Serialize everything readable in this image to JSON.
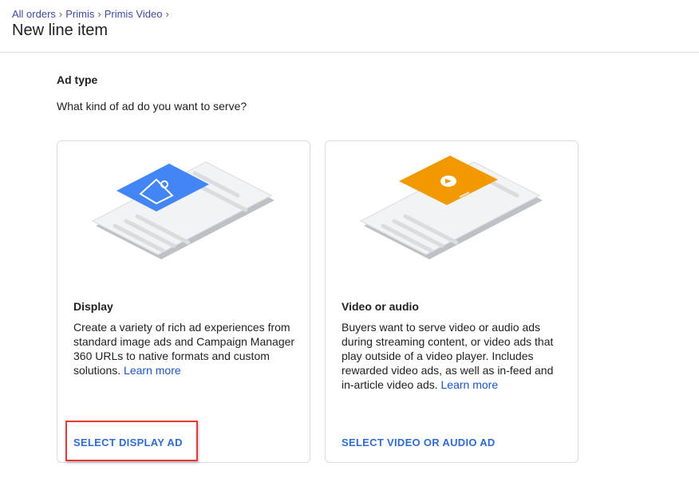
{
  "breadcrumb": {
    "items": [
      "All orders",
      "Primis",
      "Primis Video"
    ]
  },
  "header": {
    "title": "New line item"
  },
  "section": {
    "title": "Ad type",
    "question": "What kind of ad do you want to serve?"
  },
  "cards": {
    "display": {
      "title": "Display",
      "description": "Create a variety of rich ad experiences from standard image ads and Campaign Manager 360 URLs to native formats and custom solutions.",
      "learn_more": "Learn more",
      "action": "SELECT DISPLAY AD",
      "accent": "#4285f4",
      "icon": "image-icon"
    },
    "video": {
      "title": "Video or audio",
      "description": "Buyers want to serve video or audio ads during streaming content, or video ads that play outside of a video player. Includes rewarded video ads, as well as in-feed and in-article video ads.",
      "learn_more": "Learn more",
      "action": "SELECT VIDEO OR AUDIO AD",
      "accent": "#f29900",
      "icon": "play-icon"
    }
  },
  "colors": {
    "link": "#3c4ba0",
    "action": "#2f6bd0",
    "highlight": "#e53935"
  }
}
